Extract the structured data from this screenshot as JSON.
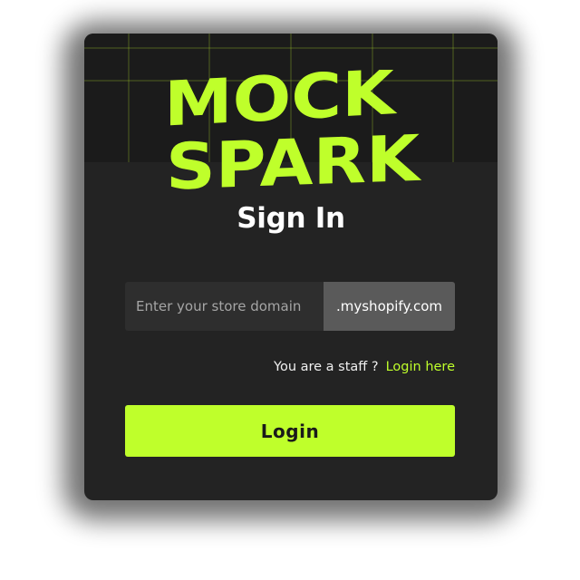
{
  "brand": {
    "logo_line1": "MOCK",
    "logo_line2": "SPARK",
    "accent_color": "#bfff2b",
    "card_color": "#232323"
  },
  "signin": {
    "title": "Sign In",
    "domain_placeholder": "Enter your store domain",
    "domain_value": "",
    "domain_suffix": ".myshopify.com",
    "staff_text": "You are a staff ?",
    "staff_link": "Login here",
    "login_label": "Login"
  }
}
